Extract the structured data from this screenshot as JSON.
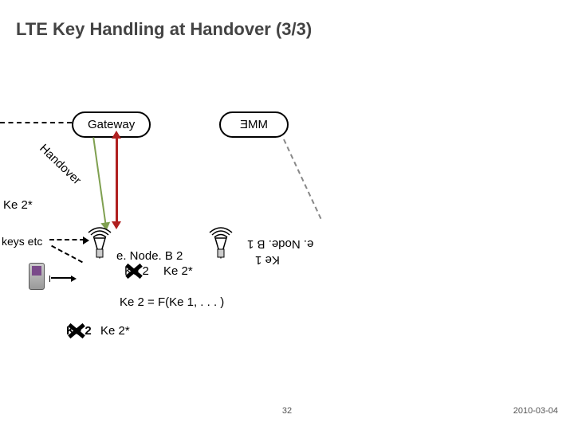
{
  "title": "LTE Key Handling at Handover (3/3)",
  "gateway": "Gateway",
  "mme": "MME",
  "handover": "Handover",
  "ke2star_left": "Ke 2*",
  "keys_etc": "keys etc",
  "enodeb2": "e. Node. B 2",
  "ke2": "Ke 2",
  "ke2star": "Ke 2*",
  "enodeb1": "e. Node. B 1",
  "ke1": "Ke 1",
  "formula": "Ke 2 = F(Ke 1, . . . )",
  "ke2_bottom": "Ke 2",
  "ke2star_bottom": "Ke 2*",
  "slide_num": "32",
  "slide_date": "2010-03-04"
}
